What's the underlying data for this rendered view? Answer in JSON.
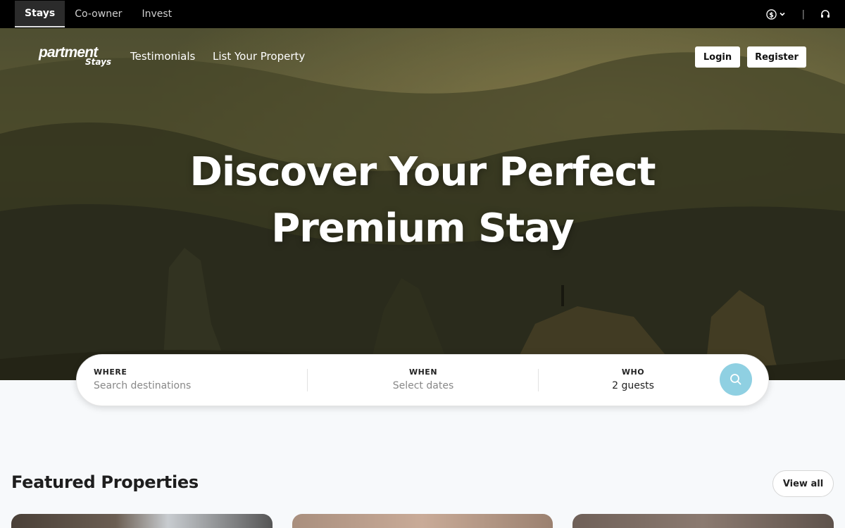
{
  "topbar": {
    "tabs": [
      {
        "label": "Stays",
        "active": true
      },
      {
        "label": "Co-owner",
        "active": false
      },
      {
        "label": "Invest",
        "active": false
      }
    ],
    "currency_icon": "dollar-circle-icon",
    "separator": "|",
    "support_icon": "headset-icon"
  },
  "nav": {
    "logo_line1": "partment",
    "logo_line2": "Stays",
    "links": [
      "Testimonials",
      "List Your Property"
    ],
    "login_label": "Login",
    "register_label": "Register"
  },
  "hero": {
    "headline_line1": "Discover Your Perfect",
    "headline_line2": "Premium Stay"
  },
  "search": {
    "where_label": "WHERE",
    "where_placeholder": "Search destinations",
    "when_label": "WHEN",
    "when_placeholder": "Select dates",
    "who_label": "WHO",
    "who_value": "2 guests",
    "button_icon": "search-icon",
    "accent": "#8fd0e2"
  },
  "featured": {
    "title": "Featured Properties",
    "view_all_label": "View all"
  }
}
